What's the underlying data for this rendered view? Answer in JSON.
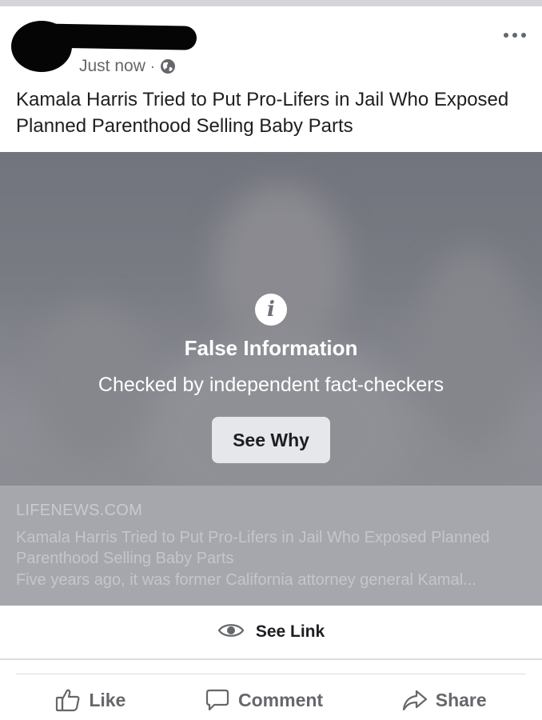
{
  "post": {
    "timestamp": "Just now",
    "separator": "·",
    "privacy_icon": "globe-icon",
    "title": "Kamala Harris Tried to Put Pro-Lifers in Jail Who Exposed Planned Parenthood Selling Baby Parts"
  },
  "overlay": {
    "icon": "info-icon",
    "heading": "False Information",
    "subtext": "Checked by independent fact-checkers",
    "button_label": "See Why"
  },
  "link_preview": {
    "domain": "LIFENEWS.COM",
    "title": "Kamala Harris Tried to Put Pro-Lifers in Jail Who Exposed Planned Parenthood Selling Baby Parts",
    "description": "Five years ago, it was former California attorney general Kamal..."
  },
  "see_link": {
    "icon": "eye-icon",
    "label": "See Link"
  },
  "actions": {
    "like": "Like",
    "comment": "Comment",
    "share": "Share"
  },
  "colors": {
    "overlay_gray": "#76787f",
    "text_primary": "#1c1e21",
    "text_secondary": "#65676b"
  }
}
